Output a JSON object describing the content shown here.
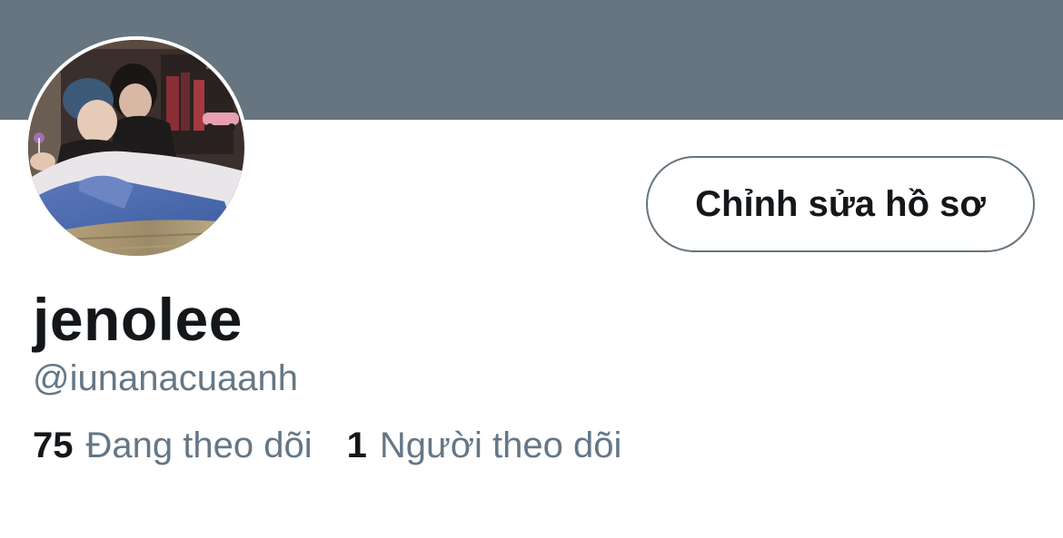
{
  "profile": {
    "display_name": "jenolee",
    "handle": "@iunanacuaanh",
    "edit_button_label": "Chỉnh sửa hồ sơ",
    "avatar": "profile-photo"
  },
  "stats": {
    "following_count": "75",
    "following_label": "Đang theo dõi",
    "followers_count": "1",
    "followers_label": "Người theo dõi"
  },
  "colors": {
    "banner": "#66757f",
    "text_primary": "#14171a",
    "text_secondary": "#657786",
    "button_border": "#66757f"
  }
}
